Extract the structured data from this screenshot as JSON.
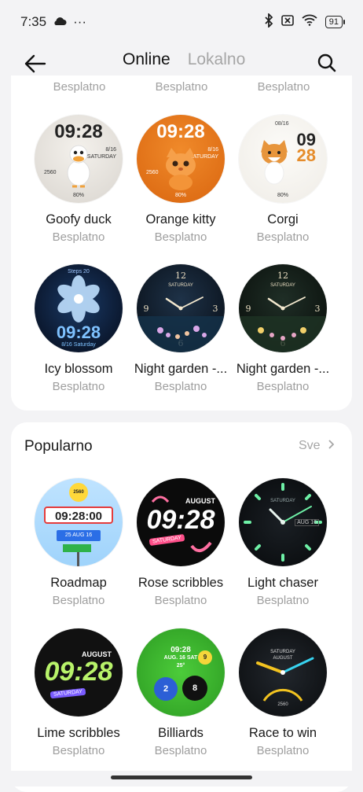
{
  "status": {
    "time": "7:35",
    "dots": "···",
    "battery": "91"
  },
  "tabs": {
    "online": "Online",
    "local": "Lokalno"
  },
  "top_partial": [
    "Besplatno",
    "Besplatno",
    "Besplatno"
  ],
  "grid1": [
    {
      "name": "Goofy duck",
      "price": "Besplatno",
      "face_time": "09:28",
      "face_date": "8/16",
      "face_day": "SATURDAY",
      "face_steps": "2560",
      "face_batt": "80%"
    },
    {
      "name": "Orange kitty",
      "price": "Besplatno",
      "face_time": "09:28",
      "face_date": "8/16",
      "face_day": "SATURDAY",
      "face_steps": "2560",
      "face_batt": "80%"
    },
    {
      "name": "Corgi",
      "price": "Besplatno",
      "face_hour": "09",
      "face_min": "28",
      "face_date": "08/16",
      "face_batt": "80%"
    },
    {
      "name": "Icy blossom",
      "price": "Besplatno",
      "face_time": "09:28",
      "face_date": "8/16 Saturday",
      "face_top": "Steps 20"
    },
    {
      "name": "Night garden -...",
      "price": "Besplatno",
      "face_day": "SATURDAY"
    },
    {
      "name": "Night garden -...",
      "price": "Besplatno",
      "face_day": "SATURDAY"
    }
  ],
  "popular": {
    "title": "Popularno",
    "see_all": "Sve",
    "items": [
      {
        "name": "Roadmap",
        "price": "Besplatno",
        "face_time": "09:28:00",
        "face_badge": "2560",
        "face_sign1": "25",
        "face_sign2": "AUG 16"
      },
      {
        "name": "Rose scribbles",
        "price": "Besplatno",
        "face_time": "09:28",
        "face_month": "AUGUST",
        "face_day": "SATURDAY"
      },
      {
        "name": "Light chaser",
        "price": "Besplatno",
        "face_day": "SATURDAY",
        "face_date": "AUG 16"
      },
      {
        "name": "Lime scribbles",
        "price": "Besplatno",
        "face_time": "09:28",
        "face_month": "AUGUST",
        "face_day": "SATURDAY"
      },
      {
        "name": "Billiards",
        "price": "Besplatno",
        "face_time": "09:28",
        "face_date": "AUG. 16 SAT",
        "face_temp": "25°",
        "ball1": "2",
        "ball2": "8",
        "ball3": "9"
      },
      {
        "name": "Race to win",
        "price": "Besplatno",
        "face_day": "SATURDAY",
        "face_month": "AUGUST",
        "face_steps": "2560"
      }
    ]
  },
  "colors": {
    "background": "#f3f3f5",
    "card": "#ffffff",
    "muted": "#9e9e9e",
    "kitty_orange": "#e87a1a",
    "lime": "#b8f36a"
  }
}
